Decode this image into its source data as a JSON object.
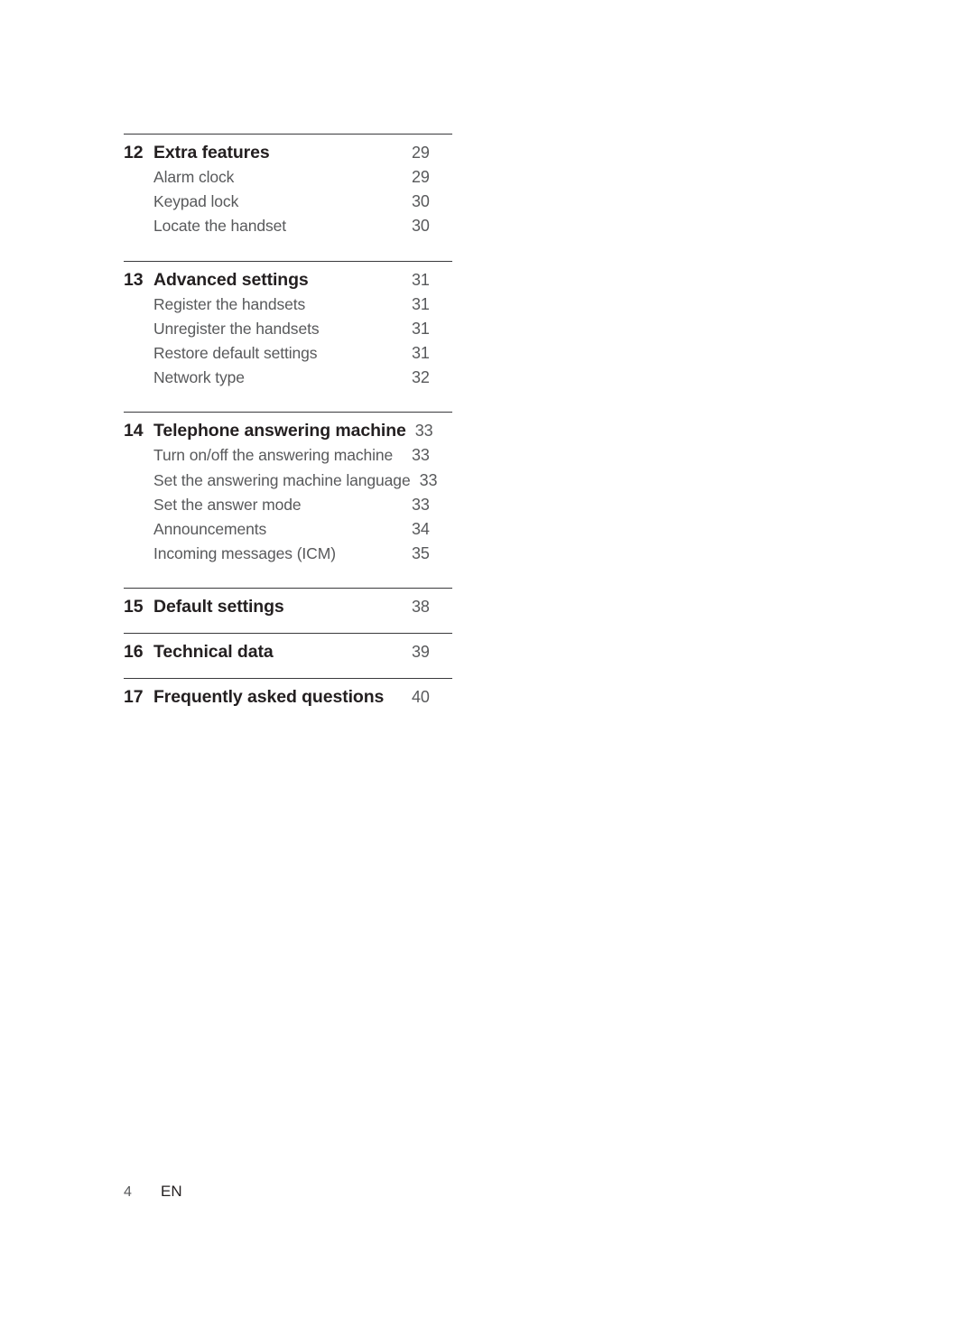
{
  "document": {
    "type": "table-of-contents",
    "footer": {
      "page_number": "4",
      "language_code": "EN"
    }
  },
  "colors": {
    "background": "#ffffff",
    "heading_text": "#231f20",
    "body_text": "#58595b",
    "rule": "#3a3a3c"
  },
  "sections": [
    {
      "number": "12",
      "title": "Extra features",
      "page": "29",
      "items": [
        {
          "label": "Alarm clock",
          "page": "29"
        },
        {
          "label": "Keypad lock",
          "page": "30"
        },
        {
          "label": "Locate the handset",
          "page": "30"
        }
      ]
    },
    {
      "number": "13",
      "title": "Advanced settings",
      "page": "31",
      "items": [
        {
          "label": "Register the handsets",
          "page": "31"
        },
        {
          "label": "Unregister the handsets",
          "page": "31"
        },
        {
          "label": "Restore default settings",
          "page": "31"
        },
        {
          "label": "Network type",
          "page": "32"
        }
      ]
    },
    {
      "number": "14",
      "title": "Telephone answering machine",
      "page": "33",
      "items": [
        {
          "label": "Turn on/off the answering machine",
          "page": "33"
        },
        {
          "label": "Set the answering machine language",
          "page": "33"
        },
        {
          "label": "Set the answer mode",
          "page": "33"
        },
        {
          "label": "Announcements",
          "page": "34"
        },
        {
          "label": "Incoming messages (ICM)",
          "page": "35"
        }
      ]
    },
    {
      "number": "15",
      "title": "Default settings",
      "page": "38",
      "items": []
    },
    {
      "number": "16",
      "title": "Technical data",
      "page": "39",
      "items": []
    },
    {
      "number": "17",
      "title": "Frequently asked questions",
      "page": "40",
      "items": []
    }
  ]
}
